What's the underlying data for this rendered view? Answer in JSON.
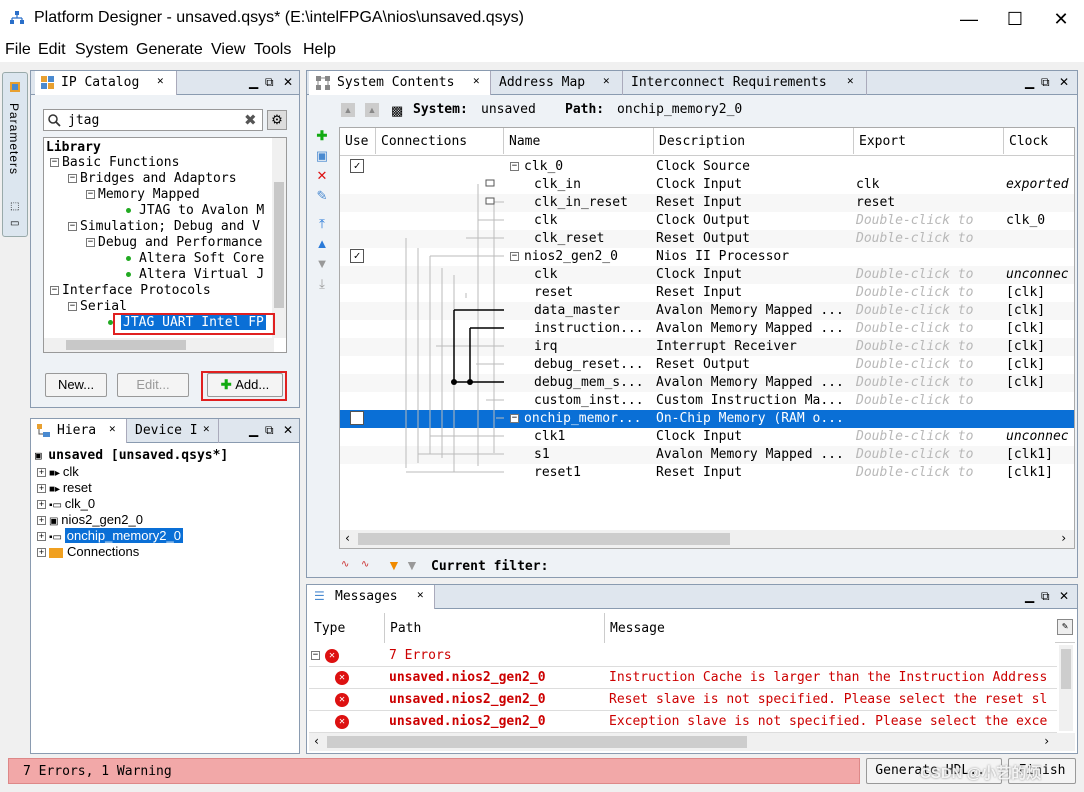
{
  "window": {
    "title": "Platform Designer - unsaved.qsys* (E:\\intelFPGA\\nios\\unsaved.qsys)",
    "minimize_glyph": "—",
    "maximize_glyph": "☐",
    "close_glyph": "✕"
  },
  "menu": [
    "File",
    "Edit",
    "System",
    "Generate",
    "View",
    "Tools",
    "Help"
  ],
  "side_tab": {
    "label": "Parameters"
  },
  "ip_catalog": {
    "tab_label": "IP Catalog",
    "search_value": "jtag",
    "tree": [
      "Library",
      "Basic Functions",
      "Bridges and Adaptors",
      "Memory Mapped",
      "JTAG to Avalon M",
      "Simulation; Debug and V",
      "Debug and Performance",
      "Altera Soft Core",
      "Altera Virtual J",
      "Interface Protocols",
      "Serial",
      "JTAG UART Intel FP"
    ],
    "buttons": {
      "new": "New...",
      "edit": "Edit...",
      "add": "Add..."
    }
  },
  "hierarchy": {
    "tabs": [
      "Hiera",
      "Device I"
    ],
    "root": "unsaved [unsaved.qsys*]",
    "items": [
      "clk",
      "reset",
      "clk_0",
      "nios2_gen2_0",
      "onchip_memory2_0",
      "Connections"
    ]
  },
  "system_contents": {
    "tabs": [
      "System Contents",
      "Address Map",
      "Interconnect Requirements"
    ],
    "system_label": "System:",
    "system_value": "unsaved",
    "path_label": "Path:",
    "path_value": "onchip_memory2_0",
    "columns": [
      "Use",
      "Connections",
      "Name",
      "Description",
      "Export",
      "Clock"
    ],
    "rows": [
      {
        "expander": "⊟",
        "name": "clk_0",
        "description": "Clock Source",
        "export": "",
        "clock": "",
        "checked": true
      },
      {
        "name": "clk_in",
        "description": "Clock Input",
        "export": "clk",
        "clock": "exported"
      },
      {
        "name": "clk_in_reset",
        "description": "Reset Input",
        "export": "reset",
        "clock": ""
      },
      {
        "name": "clk",
        "description": "Clock Output",
        "export": "Double-click to",
        "clock": "clk_0"
      },
      {
        "name": "clk_reset",
        "description": "Reset Output",
        "export": "Double-click to",
        "clock": ""
      },
      {
        "expander": "⊟",
        "name": "nios2_gen2_0",
        "description": "Nios II Processor",
        "export": "",
        "clock": "",
        "checked": true
      },
      {
        "name": "clk",
        "description": "Clock Input",
        "export": "Double-click to",
        "clock": "unconnec"
      },
      {
        "name": "reset",
        "description": "Reset Input",
        "export": "Double-click to",
        "clock": "[clk]"
      },
      {
        "name": "data_master",
        "description": "Avalon Memory Mapped ...",
        "export": "Double-click to",
        "clock": "[clk]"
      },
      {
        "name": "instruction...",
        "description": "Avalon Memory Mapped ...",
        "export": "Double-click to",
        "clock": "[clk]"
      },
      {
        "name": "irq",
        "description": "Interrupt Receiver",
        "export": "Double-click to",
        "clock": "[clk]"
      },
      {
        "name": "debug_reset...",
        "description": "Reset Output",
        "export": "Double-click to",
        "clock": "[clk]"
      },
      {
        "name": "debug_mem_s...",
        "description": "Avalon Memory Mapped ...",
        "export": "Double-click to",
        "clock": "[clk]"
      },
      {
        "name": "custom_inst...",
        "description": "Custom Instruction Ma...",
        "export": "Double-click to",
        "clock": ""
      },
      {
        "expander": "⊟",
        "name": "onchip_memor...",
        "description": "On-Chip Memory (RAM o...",
        "export": "",
        "clock": "",
        "checked": true,
        "selected": true
      },
      {
        "name": "clk1",
        "description": "Clock Input",
        "export": "Double-click to",
        "clock": "unconnec"
      },
      {
        "name": "s1",
        "description": "Avalon Memory Mapped ...",
        "export": "Double-click to",
        "clock": "[clk1]"
      },
      {
        "name": "reset1",
        "description": "Reset Input",
        "export": "Double-click to",
        "clock": "[clk1]"
      }
    ],
    "filter_label": "Current filter:"
  },
  "messages": {
    "tab_label": "Messages",
    "columns": [
      "Type",
      "Path",
      "Message"
    ],
    "group": "7 Errors",
    "rows": [
      {
        "path": "unsaved.nios2_gen2_0",
        "message": "Instruction Cache is larger than the Instruction Address"
      },
      {
        "path": "unsaved.nios2_gen2_0",
        "message": "Reset slave is not specified. Please select the reset sl"
      },
      {
        "path": "unsaved.nios2_gen2_0",
        "message": "Exception slave is not specified. Please select the exce"
      }
    ]
  },
  "status": {
    "text": "7 Errors, 1 Warning",
    "generate_button": "Generate HDL...",
    "finish_button": "Finish",
    "watermark": "CSDN @小艺的烦"
  },
  "colors": {
    "selection": "#0a6fd6",
    "error_red": "#cc0000",
    "status_bg": "#f2a8a8",
    "highlight_box": "#e02020"
  }
}
